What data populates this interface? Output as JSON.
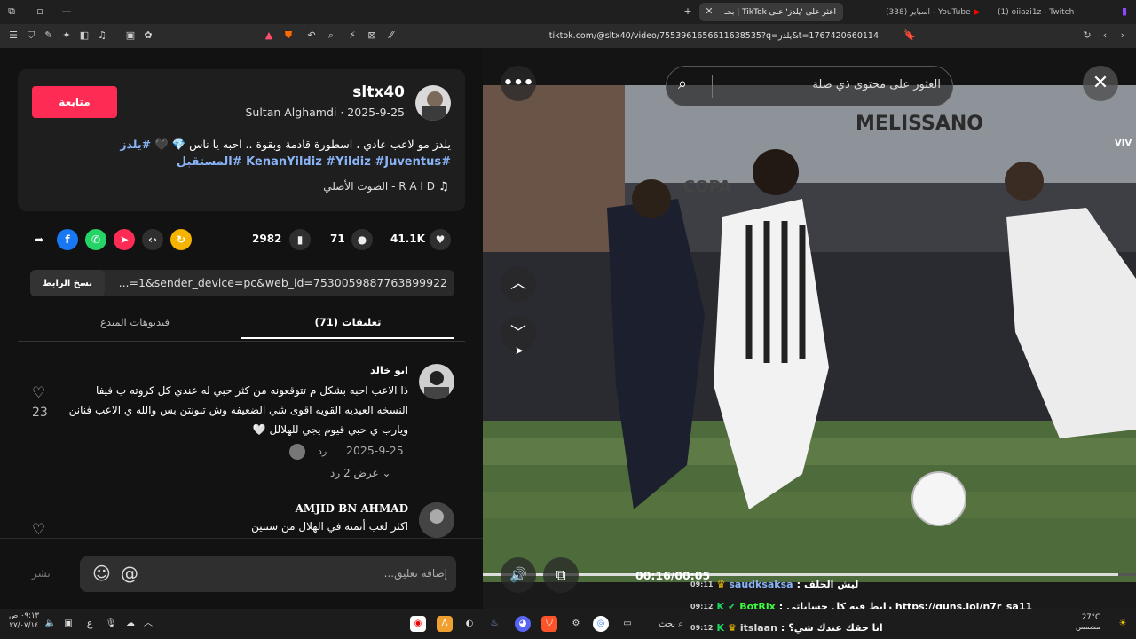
{
  "tabs": [
    {
      "label": "(1) oiiazi1z - Twitch"
    },
    {
      "label": "(338) اسباير - YouTube"
    },
    {
      "label": "اعثر على 'يلدز' على TikTok | بحـ"
    }
  ],
  "address": {
    "url": "tiktok.com/@sltx40/video/7553961656611638535?q=يلدز&t=1767420660114"
  },
  "post": {
    "username": "sltx40",
    "meta": "Sultan Alghamdi · 2025-9-25",
    "follow_label": "متابعة",
    "caption_line1": "يلدز مو لاعب عادي ، اسطورة قادمة وبقوة .. احبه يا ناس",
    "caption_tag": "#يلدز",
    "hashtags": "#KenanYildiz #Yildiz #Juventus #المستقبل",
    "music": "R A I D - الصوت الأصلي",
    "likes": "41.1K",
    "comments": "71",
    "saves": "2982",
    "link": "...=1&sender_device=pc&web_id=7530059887763899922",
    "copy_label": "نسخ الرابط"
  },
  "tabs_panel": {
    "comments": "(71) تعليقات",
    "creator": "فيديوهات المبدع"
  },
  "comments": [
    {
      "user": "ابو خالد",
      "text": "ذا الاعب احبه بشكل م تتوقعونه من كثر حبي له عندي كل كروته ب فيفا النسخه العيديه القويه اقوى شي الضعيفه وش تبونتن بس والله ي الاعب فنانن ويارب ي حبي قيوم يجي للهلالل 🤍",
      "date": "2025-9-25",
      "reply": "رد",
      "likes": "23",
      "view_replies": "عرض 2 رد"
    },
    {
      "user": "AMJID BN AHMAD",
      "text": "اكثر لعب أتمنه في الهلال من سنتين"
    }
  ],
  "composer": {
    "placeholder": "إضافة تعليق...",
    "post_label": "نشر"
  },
  "video": {
    "search_placeholder": "العثور على محتوى ذي صلة",
    "time": "00:16/00:05",
    "overlay_text": "VIV",
    "sponsor": "MELISSANO",
    "label_copa": "COPA"
  },
  "chat": [
    {
      "time": "09:11",
      "user": "saudksaksa",
      "msg": "ليش الحلف"
    },
    {
      "time": "09:12",
      "user": "BotRix",
      "msg": "رابط فيه كل حساباتي https://guns.lol/n7r_sa11"
    },
    {
      "time": "09:12",
      "user": "itslaan",
      "msg": "انا حقك عندك شي؟"
    }
  ],
  "taskbar": {
    "time": "٠٩:١٣ ص",
    "date": "٢٧/٠٧/١٤",
    "lang": "ع",
    "weather_temp": "27°C",
    "weather_desc": "مشمس",
    "search": "بحث"
  },
  "colors": {
    "accent": "#fe2c55",
    "link": "#8ab4f8",
    "bg": "#121212"
  }
}
